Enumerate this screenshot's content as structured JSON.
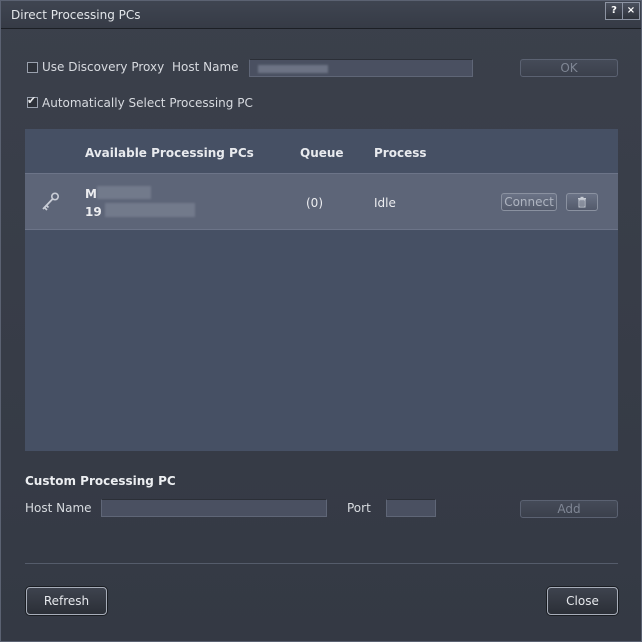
{
  "window": {
    "title": "Direct Processing PCs",
    "help_label": "?",
    "close_label": "×"
  },
  "discovery": {
    "use_proxy_label": "Use Discovery Proxy",
    "use_proxy_checked": false,
    "host_name_label": "Host Name",
    "host_name_value": "",
    "ok_label": "OK"
  },
  "auto_select": {
    "label": "Automatically Select Processing PC",
    "checked": true
  },
  "table": {
    "columns": [
      "Available Processing PCs",
      "Queue",
      "Process"
    ],
    "rows": [
      {
        "name_line1": "M",
        "name_line2": "19",
        "queue": "(0)",
        "process": "Idle",
        "connect_label": "Connect",
        "key_icon": "key-icon",
        "delete_icon": "trash-icon"
      }
    ]
  },
  "custom": {
    "section_title": "Custom Processing PC",
    "host_name_label": "Host Name",
    "host_name_value": "",
    "port_label": "Port",
    "port_value": "",
    "add_label": "Add"
  },
  "footer": {
    "refresh_label": "Refresh",
    "close_label": "Close"
  }
}
